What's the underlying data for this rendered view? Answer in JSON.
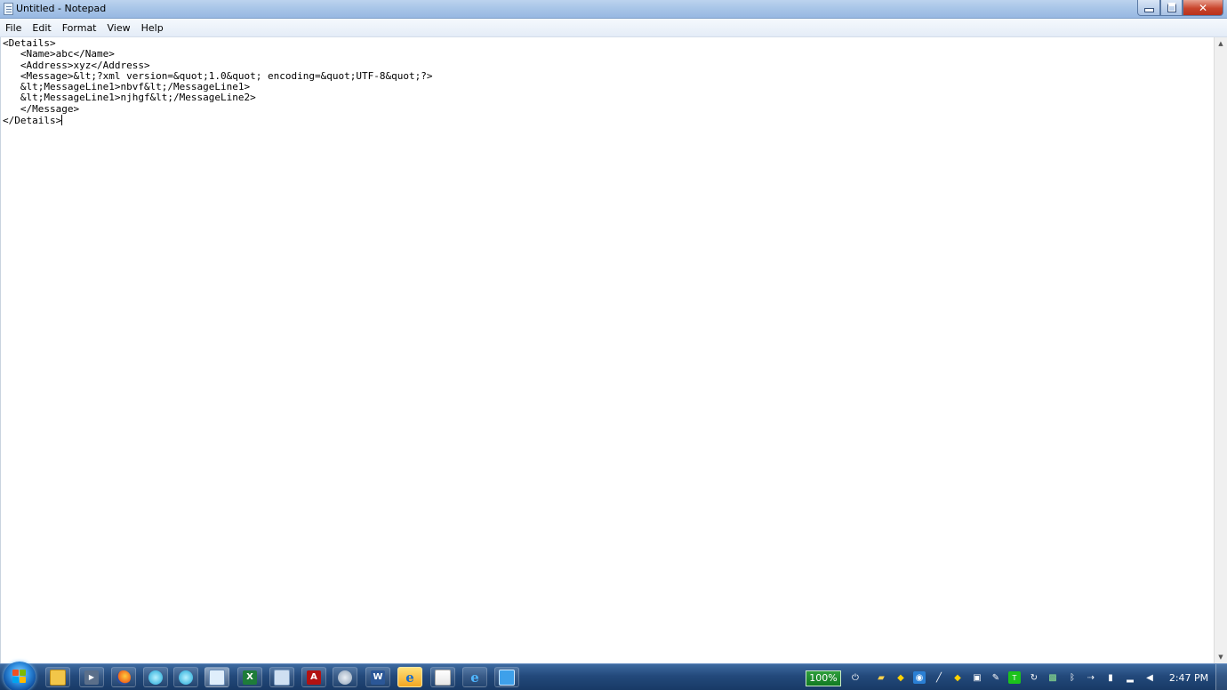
{
  "window": {
    "title": "Untitled - Notepad",
    "minimize_label": "",
    "maximize_label": "",
    "close_label": "✕"
  },
  "menu": [
    "File",
    "Edit",
    "Format",
    "View",
    "Help"
  ],
  "editor": {
    "text": "<Details>\n   <Name>abc</Name>\n   <Address>xyz</Address>\n   <Message>&lt;?xml version=&quot;1.0&quot; encoding=&quot;UTF-8&quot;?>\n   &lt;MessageLine1>nbvf&lt;/MessageLine1>\n   &lt;MessageLine1>njhgf&lt;/MessageLine2>\n   </Message>\n</Details>"
  },
  "taskbar": {
    "apps": [
      {
        "name": "explorer-icon",
        "glyph": ""
      },
      {
        "name": "media-player-icon",
        "glyph": "▶"
      },
      {
        "name": "firefox-icon",
        "glyph": ""
      },
      {
        "name": "network-globe-icon",
        "glyph": ""
      },
      {
        "name": "network-globe-icon-2",
        "glyph": ""
      },
      {
        "name": "notepad-icon",
        "glyph": ""
      },
      {
        "name": "excel-icon",
        "glyph": "X"
      },
      {
        "name": "document-icon",
        "glyph": ""
      },
      {
        "name": "acrobat-icon",
        "glyph": "A"
      },
      {
        "name": "settings-icon",
        "glyph": ""
      },
      {
        "name": "word-icon",
        "glyph": "W"
      },
      {
        "name": "internet-explorer-icon",
        "glyph": "e"
      },
      {
        "name": "java-icon",
        "glyph": ""
      },
      {
        "name": "internet-explorer-icon-2",
        "glyph": "e"
      },
      {
        "name": "blank-window-icon",
        "glyph": ""
      }
    ],
    "zoom": "100%",
    "clock": "2:47 PM"
  },
  "colors": {
    "taskbar": "#23497b",
    "titlebar": "#a9c6e8",
    "close_button": "#c9452c"
  }
}
